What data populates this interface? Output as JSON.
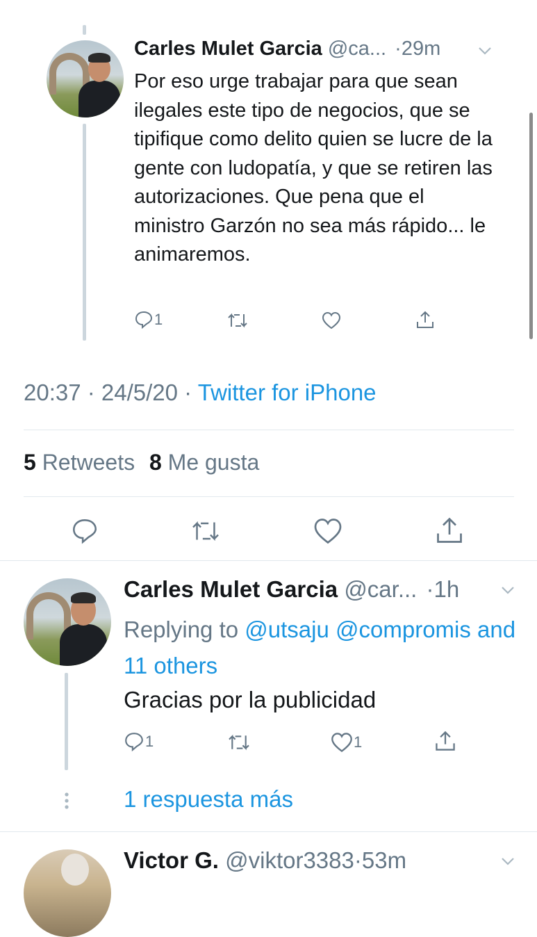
{
  "tweet1": {
    "name": "Carles Mulet Garcia",
    "handle": "@ca...",
    "sep": "·",
    "time": "29m",
    "text": "Por eso urge trabajar para que sean ilegales este tipo de negocios, que se tipifique como delito quien se lucre de la gente con ludopatía, y que se retiren las autorizaciones. Que pena que el ministro Garzón no sea más rápido... le animaremos.",
    "reply_count": "1",
    "like_count": ""
  },
  "meta": {
    "timestamp": "20:37 · 24/5/20 ·",
    "source": "Twitter for iPhone"
  },
  "stats": {
    "retweets_count": "5",
    "retweets_label": "Retweets",
    "likes_count": "8",
    "likes_label": "Me gusta"
  },
  "tweet2": {
    "name": "Carles Mulet Garcia",
    "handle": "@car...",
    "sep": "·",
    "time": "1h",
    "replying_prefix": "Replying to",
    "replying_users": "@utsaju @compromis",
    "replying_others": "and 11 others",
    "text": "Gracias por la publicidad",
    "reply_count": "1",
    "like_count": "1"
  },
  "more_replies": "1 respuesta más",
  "tweet3": {
    "name": "Victor G.",
    "handle": "@viktor3383",
    "sep": "·",
    "time": "53m"
  },
  "colors": {
    "link": "#1b95e0",
    "muted": "#657786",
    "divider": "#e1e8ed",
    "thread_line": "#ccd6dd"
  },
  "icons": [
    "reply-icon",
    "retweet-icon",
    "like-icon",
    "share-icon",
    "chevron-down-icon",
    "more-dots-icon"
  ]
}
